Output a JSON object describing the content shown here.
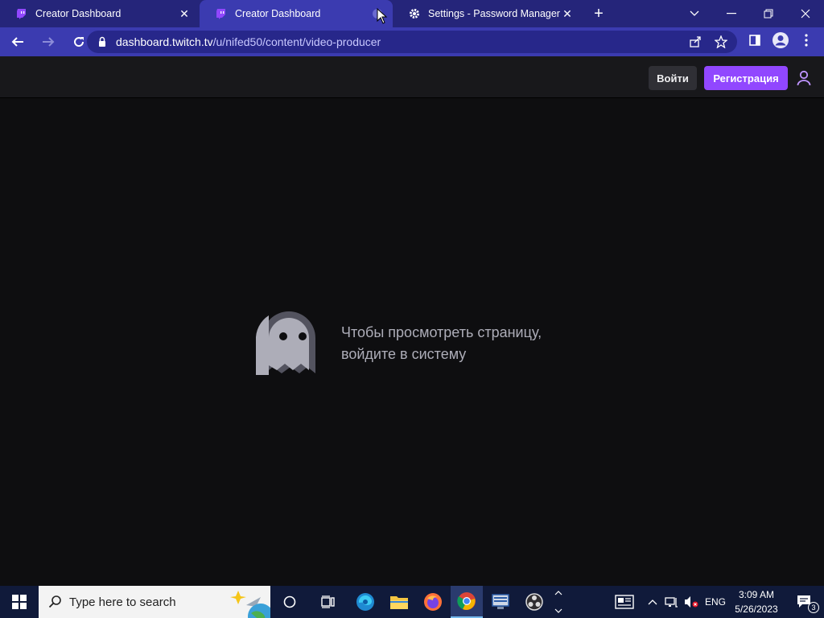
{
  "tabs": [
    {
      "title": "Creator Dashboard",
      "icon": "twitch-icon"
    },
    {
      "title": "Creator Dashboard",
      "icon": "twitch-icon"
    },
    {
      "title": "Settings - Password Manager",
      "icon": "gear-icon"
    }
  ],
  "toolbar": {
    "url_host": "dashboard.twitch.tv",
    "url_path": "/u/nifed50/content/video-producer"
  },
  "header": {
    "login_label": "Войти",
    "signup_label": "Регистрация"
  },
  "main": {
    "message_line1": "Чтобы просмотреть страницу,",
    "message_line2": "войдите в систему"
  },
  "taskbar": {
    "search_placeholder": "Type here to search",
    "language": "ENG",
    "time": "3:09 AM",
    "date": "5/26/2023",
    "notification_count": "3"
  },
  "colors": {
    "accent": "#9147ff",
    "page_bg": "#0e0e10",
    "header_bg": "#18181b",
    "browser_frame": "#3b3bb0"
  }
}
